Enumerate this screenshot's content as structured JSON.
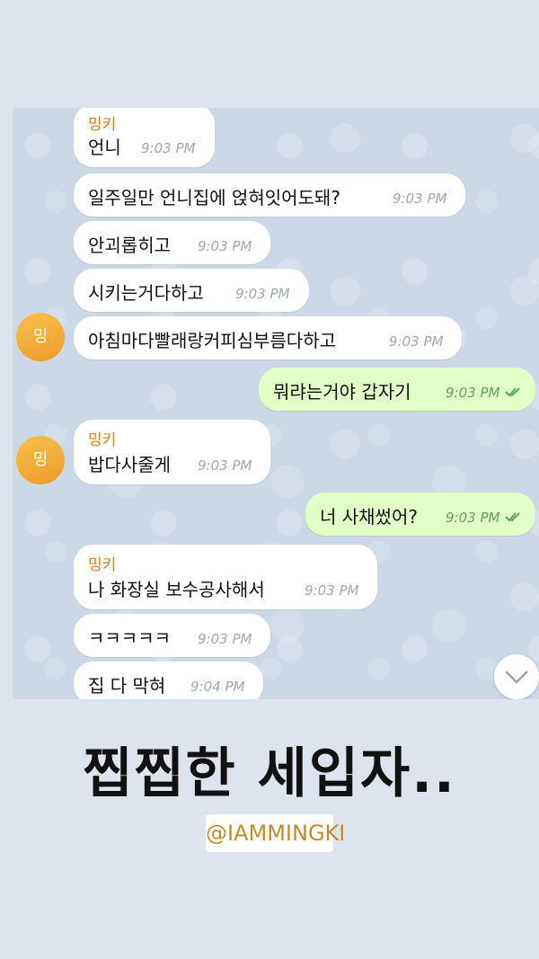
{
  "chat": {
    "sender_name": "밍키",
    "avatar_initial": "밍",
    "messages": [
      {
        "text": "언니",
        "time": "9:03 PM"
      },
      {
        "text": "일주일만 언니집에 얹혀잇어도돼?",
        "time": "9:03 PM"
      },
      {
        "text": "안괴롭히고",
        "time": "9:03 PM"
      },
      {
        "text": "시키는거다하고",
        "time": "9:03 PM"
      },
      {
        "text": "아침마다빨래랑커피심부름다하고",
        "time": "9:03 PM"
      },
      {
        "text": "뭐랴는거야 갑자기",
        "time": "9:03 PM"
      },
      {
        "text": "밥다사줄게",
        "time": "9:03 PM"
      },
      {
        "text": "너 사채썼어?",
        "time": "9:03 PM"
      },
      {
        "text": "나 화장실 보수공사해서",
        "time": "9:03 PM"
      },
      {
        "text": "ㅋㅋㅋㅋㅋ",
        "time": "9:03 PM"
      },
      {
        "text": "집 다 막혀",
        "time": "9:04 PM"
      }
    ]
  },
  "caption": "찝찝한  세입자..",
  "handle": "@IAMMINGKI",
  "colors": {
    "incoming": "#ffffff",
    "outgoing": "#e1fec6",
    "sender": "#d6802b",
    "read_check": "#5fa84f"
  },
  "icons": [
    "double-check-icon",
    "chevron-down-icon"
  ]
}
